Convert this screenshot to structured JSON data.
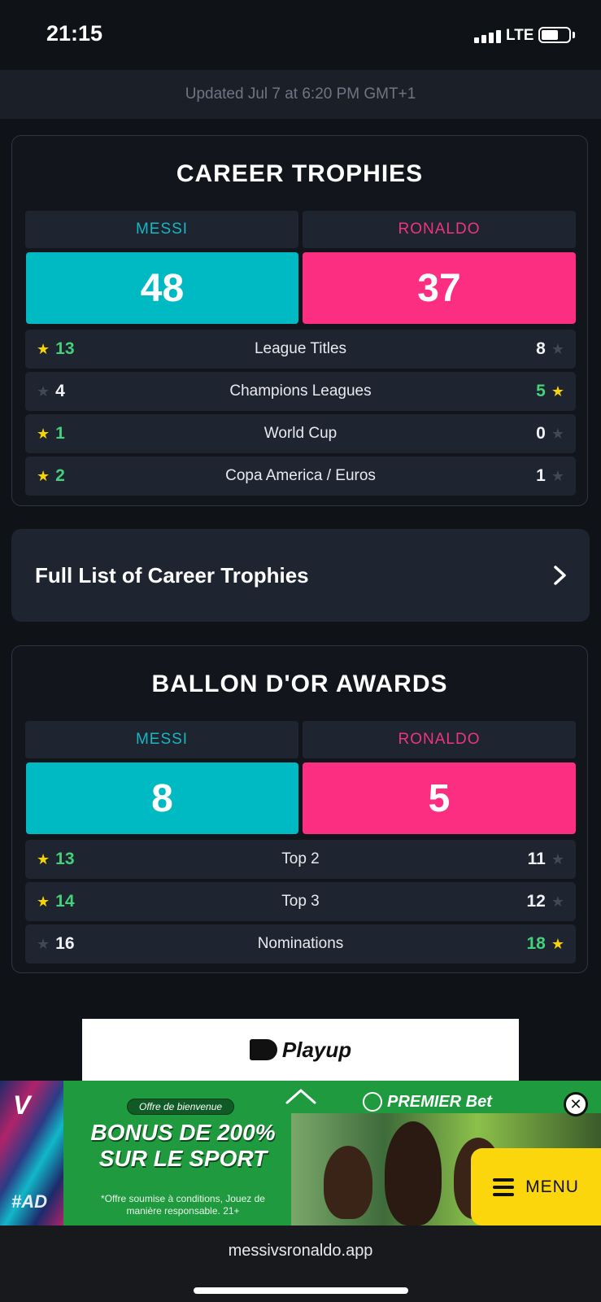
{
  "status_bar": {
    "time": "21:15",
    "network": "LTE"
  },
  "updated_text": "Updated Jul 7 at 6:20 PM GMT+1",
  "career": {
    "title": "CAREER TROPHIES",
    "player1": "MESSI",
    "player2": "RONALDO",
    "score1": "48",
    "score2": "37",
    "rows": [
      {
        "label": "League Titles",
        "left": "13",
        "right": "8",
        "winner": "left"
      },
      {
        "label": "Champions Leagues",
        "left": "4",
        "right": "5",
        "winner": "right"
      },
      {
        "label": "World Cup",
        "left": "1",
        "right": "0",
        "winner": "left"
      },
      {
        "label": "Copa America / Euros",
        "left": "2",
        "right": "1",
        "winner": "left"
      }
    ]
  },
  "full_list_link": "Full List of Career Trophies",
  "ballon": {
    "title": "BALLON D'OR AWARDS",
    "player1": "MESSI",
    "player2": "RONALDO",
    "score1": "8",
    "score2": "5",
    "rows": [
      {
        "label": "Top 2",
        "left": "13",
        "right": "11",
        "winner": "left"
      },
      {
        "label": "Top 3",
        "left": "14",
        "right": "12",
        "winner": "left"
      },
      {
        "label": "Nominations",
        "left": "16",
        "right": "18",
        "winner": "right"
      }
    ]
  },
  "ad_top": {
    "brand": "Playup"
  },
  "ad_banner": {
    "logo_letter": "V",
    "tag": "#AD",
    "pill": "Offre de bienvenue",
    "headline": "BONUS DE 200% SUR LE SPORT",
    "fine_print": "*Offre soumise à conditions, Jouez de manière responsable. 21+",
    "brand": "PREMIER Bet"
  },
  "menu_label": "MENU",
  "browser": {
    "url": "messivsronaldo.app"
  },
  "colors": {
    "messi": "#00bac3",
    "ronaldo": "#fc2e81",
    "win": "#45d07a",
    "star": "#f5d20a"
  },
  "icons": {
    "star": "star-icon",
    "chevron": "chevron-right-icon",
    "close": "close-icon",
    "menu": "hamburger-icon"
  }
}
